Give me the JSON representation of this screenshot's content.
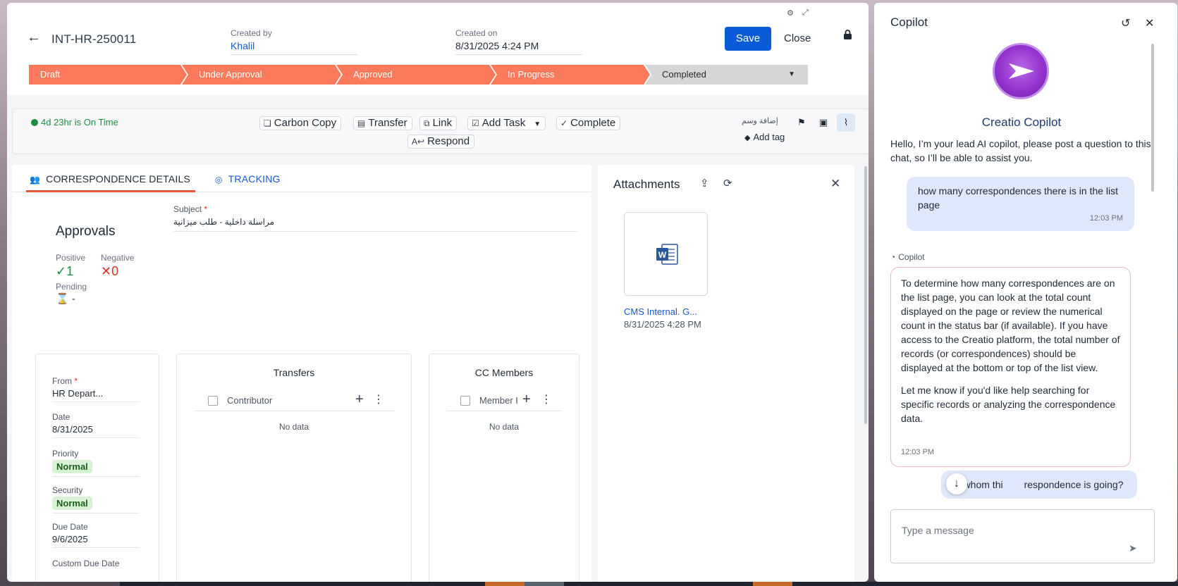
{
  "record": {
    "id": "INT-HR-250011",
    "created_by_label": "Created by",
    "created_by": "Khalil",
    "created_on_label": "Created on",
    "created_on": "8/31/2025 4:24 PM",
    "save_label": "Save",
    "close_label": "Close"
  },
  "stages": [
    "Draft",
    "Under Approval",
    "Approved",
    "In Progress",
    "Completed"
  ],
  "actions": {
    "on_time": "4d 23hr is On Time",
    "carbon_copy": "Carbon Copy",
    "transfer": "Transfer",
    "link": "Link",
    "add_task": "Add Task",
    "complete": "Complete",
    "respond": "Respond",
    "arabic_tag": "إضافة وسم",
    "add_tag": "Add tag"
  },
  "tabs": {
    "details": "CORRESPONDENCE DETAILS",
    "tracking": "TRACKING"
  },
  "subject": {
    "label": "Subject",
    "value": "مراسلة داخلية - طلب ميزانية"
  },
  "approvals": {
    "title": "Approvals",
    "positive_label": "Positive",
    "positive_value": "1",
    "negative_label": "Negative",
    "negative_value": "0",
    "pending_label": "Pending",
    "pending_value": "-"
  },
  "fields": {
    "from_label": "From",
    "from_value": "HR Depart...",
    "date_label": "Date",
    "date_value": "8/31/2025",
    "priority_label": "Priority",
    "priority_value": "Normal",
    "security_label": "Security",
    "security_value": "Normal",
    "due_label": "Due Date",
    "due_value": "9/6/2025",
    "custom_due_label": "Custom Due Date"
  },
  "transfers": {
    "title": "Transfers",
    "column": "Contributor",
    "empty": "No data"
  },
  "cc_members": {
    "title": "CC Members",
    "column": "Member I",
    "empty": "No data"
  },
  "attachments": {
    "title": "Attachments",
    "file_name": "CMS Internal. G...",
    "file_date": "8/31/2025 4:28 PM"
  },
  "copilot": {
    "title": "Copilot",
    "name": "Creatio Copilot",
    "intro": "Hello, I’m your lead AI copilot, please post a question to this chat, so I’ll be able to assist you.",
    "msg1": "how many correspondences there is in the list page",
    "msg1_time": "12:03 PM",
    "sender": "Copilot",
    "reply_p1": "To determine how many correspondences are on the list page, you can look at the total count displayed on the page or review the numerical count in the status bar (if available). If you have access to the Creatio platform, the total number of records (or correspondences) should be displayed at the bottom or top of the list view.",
    "reply_p2": "Let me know if you'd like help searching for specific records or analyzing the correspondence data.",
    "reply_time": "12:03 PM",
    "msg2_left": "to whom thi",
    "msg2_right": "respondence is going?",
    "input_placeholder": "Type a message"
  },
  "colors": {
    "stage_active": "#fb7a5c",
    "stage_inactive": "#d6d6d6",
    "primary": "#0a5bd8",
    "tab_underline": "#e8533a",
    "positive": "#1e8e3e",
    "negative": "#d93025"
  },
  "icons": [
    "back-arrow-icon",
    "lock-icon",
    "clock-icon",
    "layers-icon",
    "transfer-icon",
    "link-icon",
    "task-icon",
    "check-icon",
    "reply-icon",
    "tag-icon",
    "flag-icon",
    "chat-icon",
    "paperclip-icon",
    "people-icon",
    "target-icon",
    "hourglass-icon",
    "upload-icon",
    "refresh-icon",
    "close-icon",
    "word-file-icon",
    "reset-icon",
    "send-icon",
    "arrow-down-icon"
  ]
}
